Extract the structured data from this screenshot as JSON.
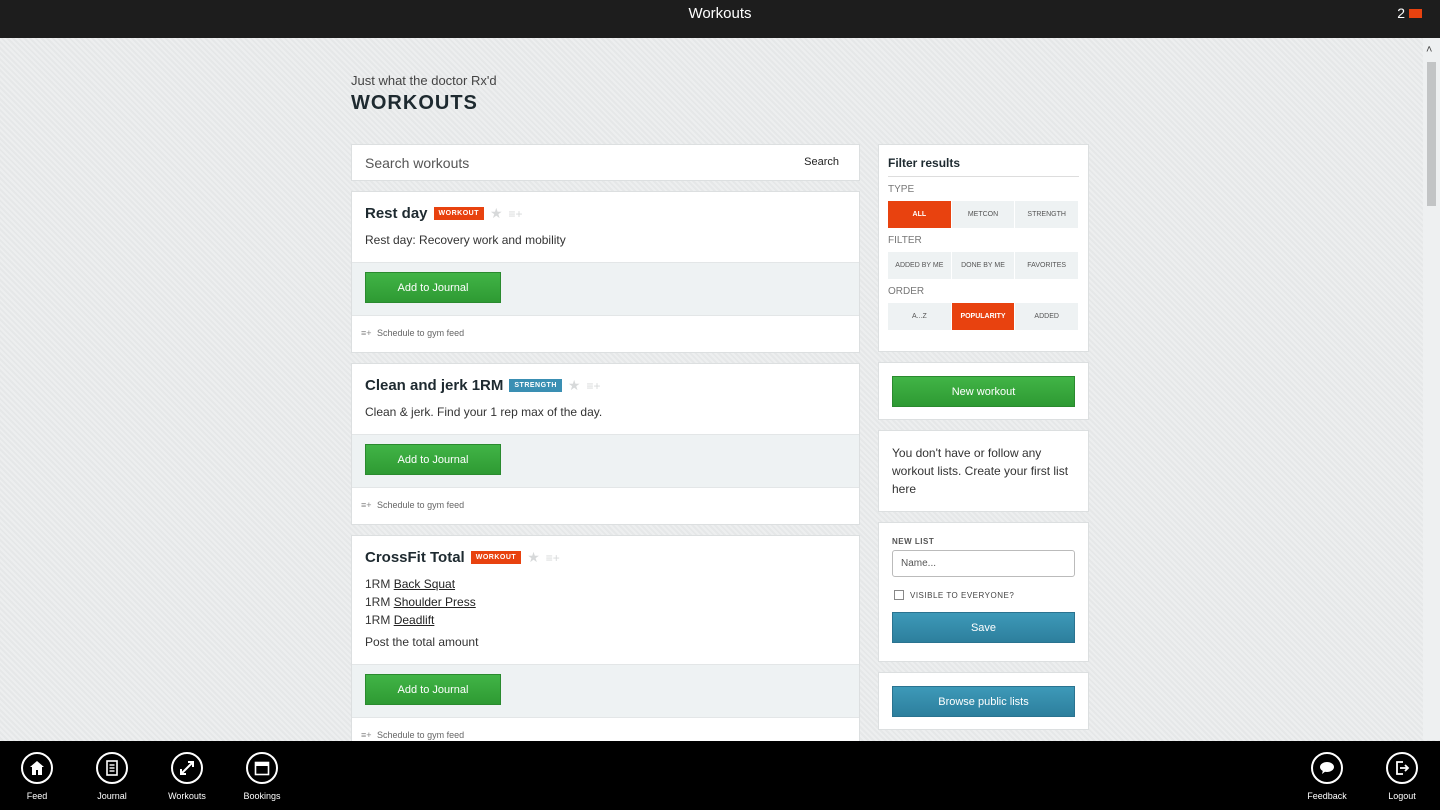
{
  "window": {
    "title": "Workouts",
    "notification_count": "2"
  },
  "page": {
    "subtitle": "Just what the doctor Rx'd",
    "heading": "WORKOUTS"
  },
  "search": {
    "placeholder": "Search workouts",
    "button_label": "Search"
  },
  "workouts": [
    {
      "title": "Rest day",
      "badge": "WORKOUT",
      "badge_color": "#e8420f",
      "description": "Rest day: Recovery work and mobility",
      "add_label": "Add to Journal",
      "schedule_label": "Schedule to gym feed"
    },
    {
      "title": "Clean and jerk 1RM",
      "badge": "STRENGTH",
      "badge_color": "#3a8fb3",
      "description": "Clean & jerk. Find your 1 rep max of the day.",
      "add_label": "Add to Journal",
      "schedule_label": "Schedule to gym feed"
    },
    {
      "title": "CrossFit Total",
      "badge": "WORKOUT",
      "badge_color": "#e8420f",
      "lines": [
        {
          "prefix": "1RM",
          "link": "Back Squat"
        },
        {
          "prefix": "1RM",
          "link": "Shoulder Press"
        },
        {
          "prefix": "1RM",
          "link": "Deadlift"
        }
      ],
      "description": "Post the total amount",
      "add_label": "Add to Journal",
      "schedule_label": "Schedule to gym feed"
    }
  ],
  "filter": {
    "title": "Filter results",
    "type_label": "TYPE",
    "type_options": [
      "ALL",
      "METCON",
      "STRENGTH"
    ],
    "type_active": "ALL",
    "filter_label": "FILTER",
    "filter_options": [
      "ADDED BY ME",
      "DONE BY ME",
      "FAVORITES"
    ],
    "order_label": "ORDER",
    "order_options": [
      "A...Z",
      "POPULARITY",
      "ADDED"
    ],
    "order_active": "POPULARITY"
  },
  "sidebar": {
    "new_workout_label": "New workout",
    "no_lists_text": "You don't have or follow any workout lists. Create your first list here",
    "new_list_label": "NEW LIST",
    "name_placeholder": "Name...",
    "visible_label": "VISIBLE TO EVERYONE?",
    "save_label": "Save",
    "browse_label": "Browse public lists"
  },
  "appbar": {
    "items": [
      {
        "label": "Feed",
        "icon": "home-icon"
      },
      {
        "label": "Journal",
        "icon": "journal-icon"
      },
      {
        "label": "Workouts",
        "icon": "workouts-icon"
      },
      {
        "label": "Bookings",
        "icon": "calendar-icon"
      },
      {
        "label": "Feedback",
        "icon": "chat-icon"
      },
      {
        "label": "Logout",
        "icon": "logout-icon"
      }
    ]
  }
}
